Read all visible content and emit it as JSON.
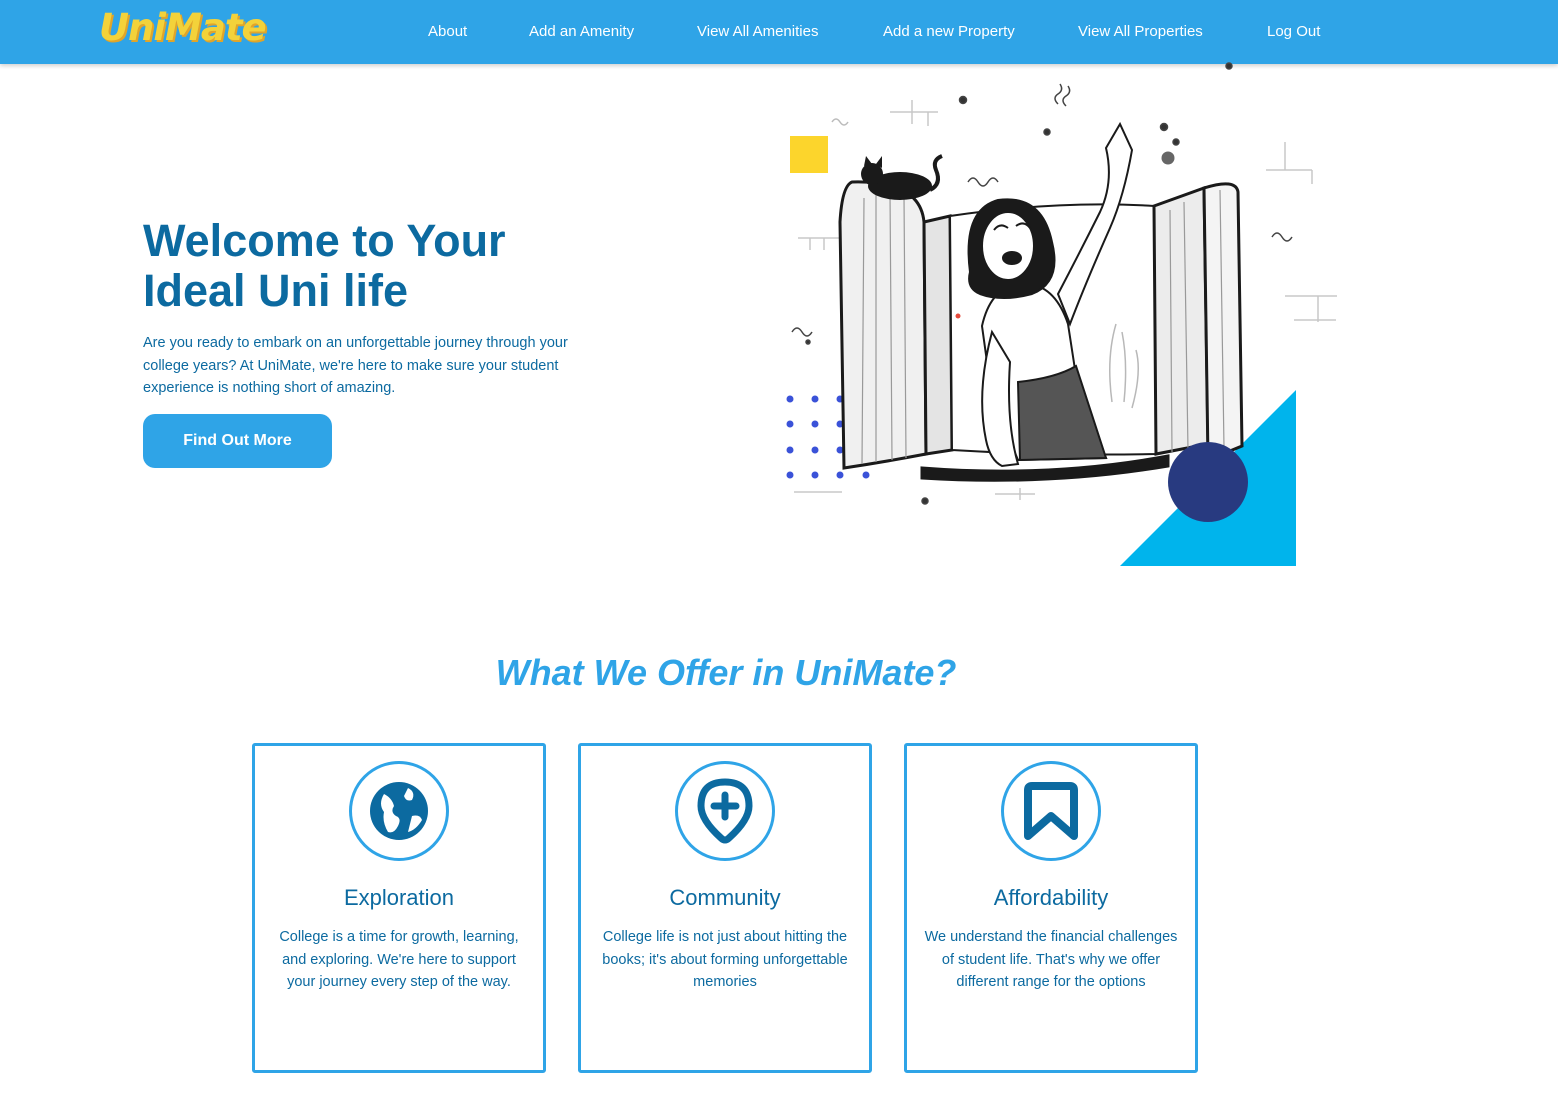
{
  "nav": {
    "logo": "UniMate",
    "links": [
      {
        "label": "About"
      },
      {
        "label": "Add an Amenity"
      },
      {
        "label": "View All Amenities"
      },
      {
        "label": "Add a new Property"
      },
      {
        "label": "View All Properties"
      },
      {
        "label": "Log Out"
      }
    ]
  },
  "hero": {
    "title_line1": "Welcome to Your",
    "title_line2": "Ideal Uni life",
    "text": "Are you ready to embark on an unforgettable journey through your college years? At UniMate, we're here to make sure your student experience is nothing short of amazing.",
    "button": "Find Out More"
  },
  "offer": {
    "title": "What We Offer in UniMate?",
    "cards": [
      {
        "icon": "globe-icon",
        "title": "Exploration",
        "text": "College is a time for growth, learning, and exploring. We're here to support your journey every step of the way."
      },
      {
        "icon": "location-plus-icon",
        "title": "Community",
        "text": "College life is not just about hitting the books; it's about forming unforgettable memories"
      },
      {
        "icon": "bookmark-icon",
        "title": "Affordability",
        "text": "We understand the financial challenges of student life. That's why we offer different range for the options"
      }
    ]
  },
  "colors": {
    "primary": "#2fa4e7",
    "text_dark_blue": "#0c6aa0",
    "logo_yellow": "#f3d23a",
    "accent_navy": "#283a80",
    "accent_cyan": "#00b4ec"
  }
}
